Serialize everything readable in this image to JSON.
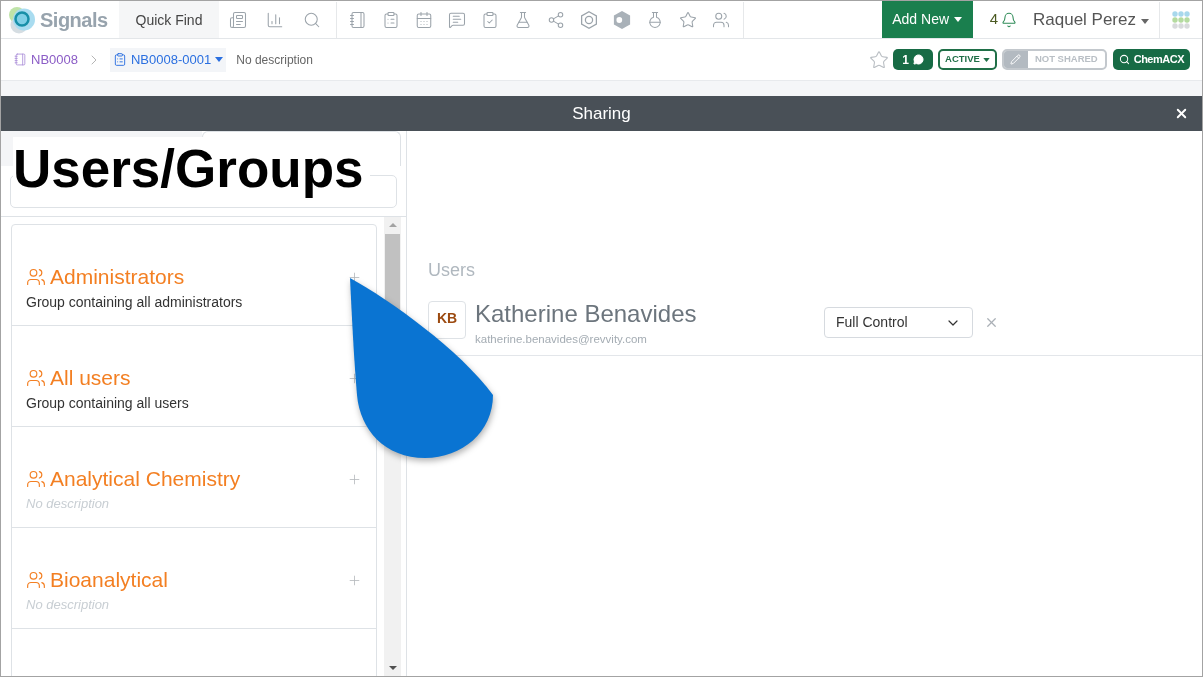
{
  "navbar": {
    "logo_text": "Signals",
    "quick_find": {
      "placeholder": "Quick Find"
    },
    "add_new": "Add New",
    "notification_count": "4",
    "user_name": "Raquel Perez"
  },
  "breadcrumb": {
    "notebook": "NB0008",
    "experiment": "NB0008-0001",
    "description": "No description",
    "favorite": false,
    "comment_count": "1",
    "status": "ACTIVE",
    "sharing": "NOT SHARED",
    "lookup_button": "ChemACX"
  },
  "dialog": {
    "title": "Sharing",
    "tabs": [
      {
        "selected": false
      },
      {
        "selected": true
      }
    ],
    "annotation": "Users/Groups",
    "groups": [
      {
        "name": "Administrators",
        "description": "Group containing all administrators",
        "description_empty": false
      },
      {
        "name": "All users",
        "description": "Group containing all users",
        "description_empty": false
      },
      {
        "name": "Analytical Chemistry",
        "description": "No description",
        "description_empty": true
      },
      {
        "name": "Bioanalytical",
        "description": "No description",
        "description_empty": true
      }
    ],
    "users_heading": "Users",
    "users": [
      {
        "initials": "KB",
        "name": "Katherine Benavides",
        "email": "katherine.benavides@revvity.com",
        "permission": "Full Control"
      }
    ]
  }
}
